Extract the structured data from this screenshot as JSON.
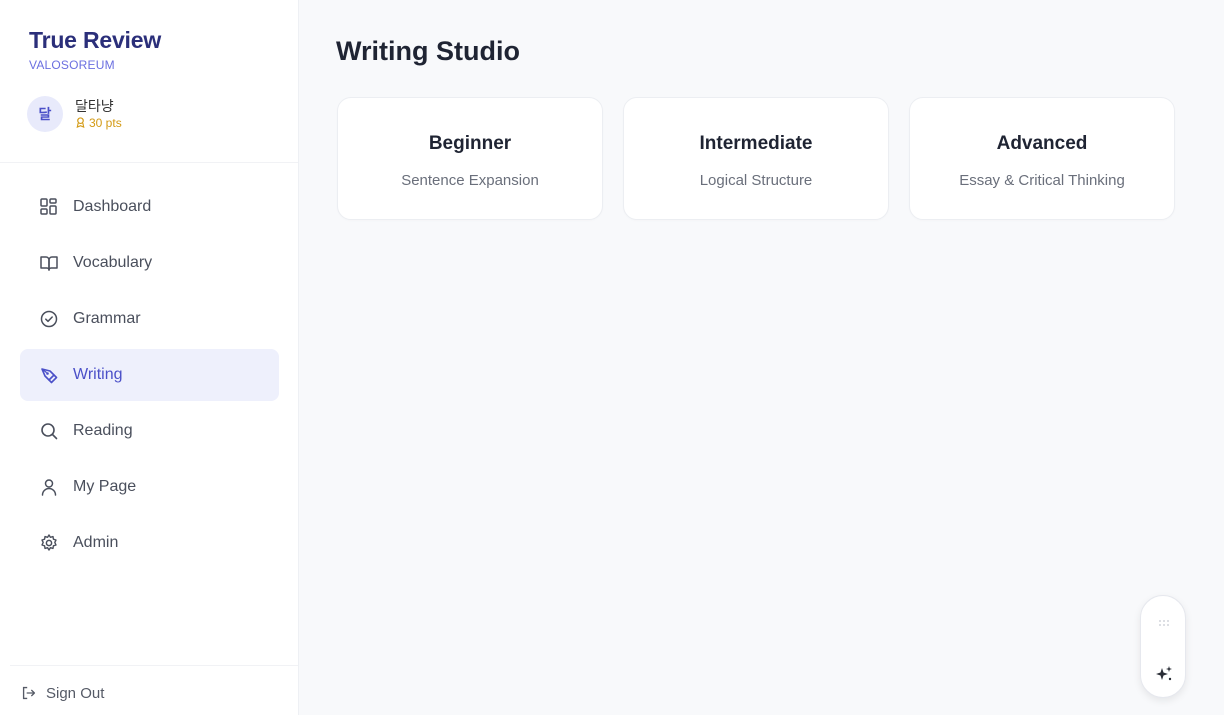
{
  "brand": {
    "title": "True Review",
    "subtitle": "VALOSOREUM"
  },
  "user": {
    "avatar_initial": "달",
    "name": "달타냥",
    "points": "30 pts"
  },
  "nav": {
    "items": [
      {
        "label": "Dashboard",
        "icon": "dashboard-grid-icon",
        "active": false
      },
      {
        "label": "Vocabulary",
        "icon": "book-open-icon",
        "active": false
      },
      {
        "label": "Grammar",
        "icon": "check-circle-icon",
        "active": false
      },
      {
        "label": "Writing",
        "icon": "pen-tool-icon",
        "active": true
      },
      {
        "label": "Reading",
        "icon": "search-icon",
        "active": false
      },
      {
        "label": "My Page",
        "icon": "user-icon",
        "active": false
      },
      {
        "label": "Admin",
        "icon": "gear-icon",
        "active": false
      }
    ]
  },
  "signout": {
    "label": "Sign Out",
    "icon": "logout-icon"
  },
  "main": {
    "title": "Writing Studio",
    "cards": [
      {
        "title": "Beginner",
        "subtitle": "Sentence Expansion"
      },
      {
        "title": "Intermediate",
        "subtitle": "Logical Structure"
      },
      {
        "title": "Advanced",
        "subtitle": "Essay & Critical Thinking"
      }
    ]
  },
  "floating": {
    "handle_icon": "drag-handle-icon",
    "action_icon": "sparkle-icon"
  },
  "colors": {
    "brand": "#2b2f7a",
    "accent": "#4b50c8",
    "accent_bg": "#eef0fc",
    "points": "#d39a14",
    "main_bg": "#f8f9fb"
  }
}
